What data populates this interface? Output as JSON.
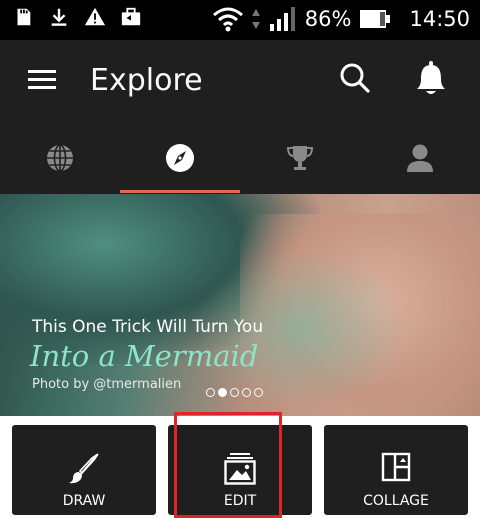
{
  "status_bar": {
    "battery": "86%",
    "time": "14:50",
    "icons": [
      "sd-card-icon",
      "download-icon",
      "warning-icon",
      "briefcase-icon",
      "wifi-icon",
      "signal-icon",
      "battery-icon"
    ]
  },
  "app_bar": {
    "title": "Explore",
    "icons": [
      "menu-icon",
      "search-icon",
      "bell-icon"
    ]
  },
  "tabs": [
    {
      "icon": "globe-icon",
      "active": false
    },
    {
      "icon": "compass-icon",
      "active": true
    },
    {
      "icon": "trophy-icon",
      "active": false
    },
    {
      "icon": "profile-icon",
      "active": false
    }
  ],
  "banner": {
    "line1": "This One Trick Will Turn You",
    "line2": "Into a Mermaid",
    "credit": "Photo by @tmermalien",
    "pages": 5,
    "current_page": 1
  },
  "actions": [
    {
      "label": "DRAW",
      "icon": "brush-icon"
    },
    {
      "label": "EDIT",
      "icon": "image-stack-icon"
    },
    {
      "label": "COLLAGE",
      "icon": "collage-icon"
    }
  ],
  "colors": {
    "tab_indicator": "#e06b50",
    "highlight": "#e0242c",
    "app_bar": "#1f1f1f",
    "mermaid_text": "#8ee3c9"
  }
}
